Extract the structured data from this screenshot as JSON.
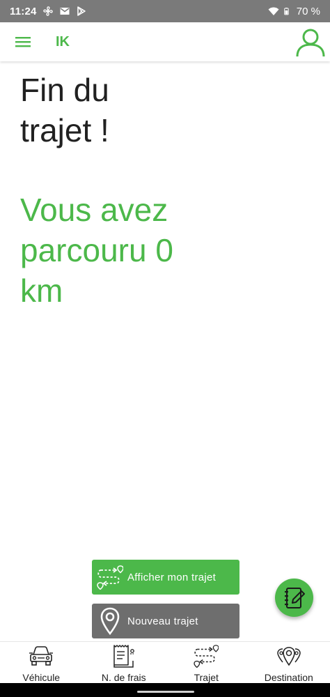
{
  "status_bar": {
    "time": "11:24",
    "battery": "70 %",
    "icons": [
      "fan-icon",
      "mail-icon",
      "play-store-icon",
      "wifi-icon",
      "battery-icon"
    ]
  },
  "app_bar": {
    "title": "IK",
    "menu_icon": "hamburger-menu-icon",
    "profile_icon": "user-profile-icon"
  },
  "main": {
    "title": "Fin du trajet !",
    "result": "Vous avez parcouru 0 km"
  },
  "actions": {
    "show_route_label": "Afficher mon trajet",
    "new_route_label": "Nouveau trajet",
    "fab_icon": "notebook-edit-icon"
  },
  "bottom_nav": [
    {
      "label": "Véhicule",
      "icon": "car-icon"
    },
    {
      "label": "N. de frais",
      "icon": "receipt-icon"
    },
    {
      "label": "Trajet",
      "icon": "route-icon"
    },
    {
      "label": "Destination",
      "icon": "destination-pins-icon"
    }
  ],
  "colors": {
    "accent": "#4cb84a",
    "secondary_button": "#6e6e6e",
    "status_bar": "#7a7a7a"
  }
}
